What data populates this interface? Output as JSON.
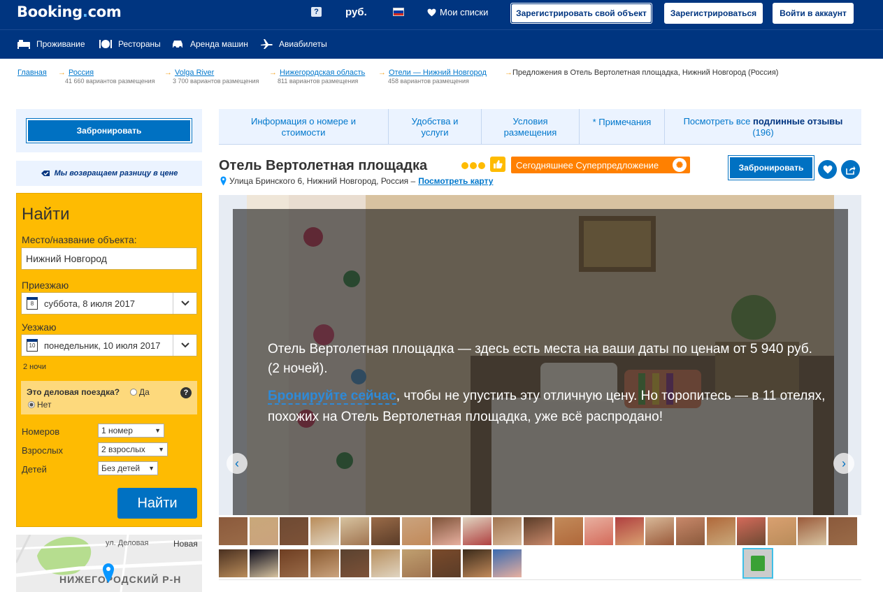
{
  "header": {
    "logo_main": "Booking",
    "logo_dot": ".",
    "logo_com": "com",
    "help": "?",
    "currency": "руб.",
    "flag_colors": [
      "#ffffff",
      "#0039a6",
      "#d52b1e"
    ],
    "wishlist": "Мои списки",
    "register_property": "Зарегистрировать свой объект",
    "register": "Зарегистрироваться",
    "login": "Войти в аккаунт"
  },
  "nav": {
    "items": [
      {
        "label": "Проживание",
        "icon": "bed-icon"
      },
      {
        "label": "Рестораны",
        "icon": "restaurant-icon"
      },
      {
        "label": "Аренда машин",
        "icon": "car-icon"
      },
      {
        "label": "Авиабилеты",
        "icon": "plane-icon"
      }
    ]
  },
  "breadcrumbs": [
    {
      "label": "Главная",
      "sub": ""
    },
    {
      "label": "Россия",
      "sub": "41 660 вариантов размещения"
    },
    {
      "label": "Volga River",
      "sub": "3 700 вариантов размещения"
    },
    {
      "label": "Нижегородская область",
      "sub": "811 вариантов размещения"
    },
    {
      "label": "Отели — Нижний Новгород",
      "sub": "458 вариантов размещения"
    }
  ],
  "breadcrumb_current": "Предложения в Отель Вертолетная площадка, Нижний Новгород (Россия)",
  "sidebar": {
    "book_button": "Забронировать",
    "price_match": "Мы возвращаем разницу в цене",
    "search": {
      "title": "Найти",
      "destination_label": "Место/название объекта:",
      "destination_value": "Нижний Новгород",
      "checkin_label": "Приезжаю",
      "checkin_day": "8",
      "checkin_value": "суббота, 8 июля 2017",
      "checkout_label": "Уезжаю",
      "checkout_day": "10",
      "checkout_value": "понедельник, 10 июля 2017",
      "nights": "2 ночи",
      "business_question": "Это деловая поездка?",
      "business_yes": "Да",
      "business_no": "Нет",
      "business_help": "?",
      "rooms_label": "Номеров",
      "rooms_value": "1 номер",
      "adults_label": "Взрослых",
      "adults_value": "2 взрослых",
      "children_label": "Детей",
      "children_value": "Без детей",
      "submit": "Найти"
    },
    "map": {
      "street": "ул. Деловая",
      "district": "НИЖЕГОРОДСКИЙ Р-Н",
      "area": "Новая"
    }
  },
  "tabs": {
    "info": "Информация о номере и стоимости",
    "amenities": "Удобства и услуги",
    "conditions": "Условия размещения",
    "notes": "* Примечания",
    "reviews_prefix": "Посмотреть все",
    "reviews_bold": "подлинные отзывы",
    "reviews_count": "(196)"
  },
  "hotel": {
    "name": "Отель Вертолетная площадка",
    "stars": 3,
    "super_deal": "Сегодняшнее Суперпредложение",
    "address": "Улица Бринского 6, Нижний Новгород, Россия –",
    "show_map": "Посмотреть карту",
    "book_button": "Забронировать"
  },
  "overlay": {
    "line1": "Отель Вертолетная площадка — здесь есть места на ваши даты по ценам от 5 940 руб. (2 ночей).",
    "book_now": "Бронируйте сейчас",
    "line2": ", чтобы не упустить эту отличную цену. Но торопитесь — в 11 отелях, похожих на Отель Вертолетная площадка, уже всё распродано!"
  },
  "colors": {
    "brand": "#003580",
    "accent": "#0071c2",
    "yellow": "#febb02",
    "orange": "#ff8000"
  }
}
